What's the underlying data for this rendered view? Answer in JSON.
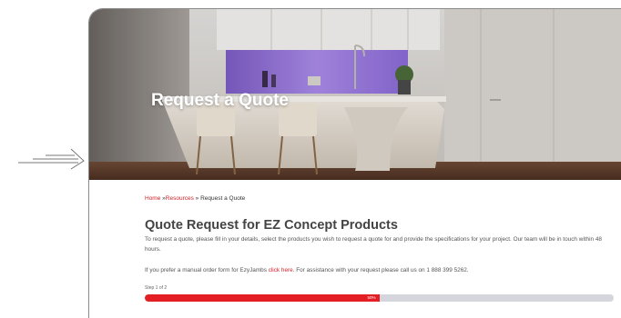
{
  "hero": {
    "title": "Request a Quote"
  },
  "breadcrumb": {
    "home": "Home",
    "sep1": "»",
    "resources": "Resources",
    "sep2": "»",
    "current": "Request a Quote"
  },
  "heading": "Quote Request for EZ Concept Products",
  "intro": "To request a quote, please fill in your details, select the products you wish to request a quote for and provide the specifications for your project. Our team will be in touch within 48 hours.",
  "manual": {
    "before": "If you prefer a manual order form for EzyJambs",
    "link": "click here",
    "after": ". For assistance with your request please call us on 1 888 399 5262."
  },
  "progress": {
    "step_label": "Step 1 of 2",
    "percent_label": "50%",
    "value": 0.5
  },
  "colors": {
    "accent": "#e31e24",
    "link": "#d2232a",
    "track": "#d5d5dd"
  }
}
